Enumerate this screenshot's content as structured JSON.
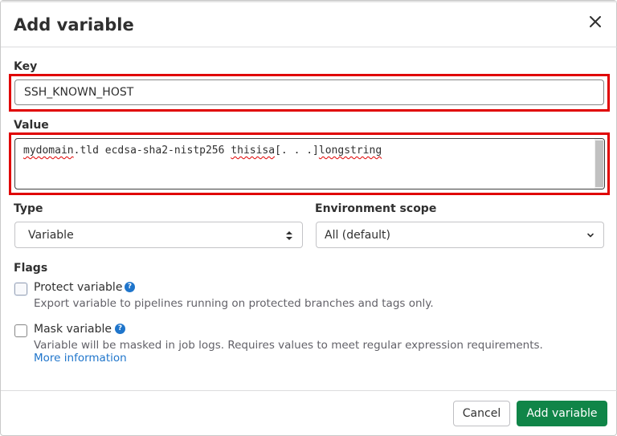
{
  "dialog": {
    "title": "Add variable",
    "close_icon": "close-icon"
  },
  "key": {
    "label": "Key",
    "value": "SSH_KNOWN_HOST"
  },
  "value_field": {
    "label": "Value",
    "parts": [
      "mydomain",
      ".tld ecdsa-sha2-nistp256 ",
      "thisisa",
      "[. . .]",
      "longstring"
    ]
  },
  "type": {
    "label": "Type",
    "selected": "Variable",
    "icon": "sort-icon"
  },
  "environment_scope": {
    "label": "Environment scope",
    "selected": "All (default)",
    "icon": "chevron-down-icon"
  },
  "flags": {
    "label": "Flags",
    "protect": {
      "label": "Protect variable",
      "description": "Export variable to pipelines running on protected branches and tags only.",
      "help_icon": "question-icon"
    },
    "mask": {
      "label": "Mask variable",
      "description": "Variable will be masked in job logs. Requires values to meet regular expression requirements.",
      "link": "More information",
      "help_icon": "question-icon"
    }
  },
  "footer": {
    "cancel_label": "Cancel",
    "submit_label": "Add variable"
  },
  "colors": {
    "primary_button": "#108548",
    "link": "#1f75cb",
    "highlight_outline": "#e00000"
  }
}
